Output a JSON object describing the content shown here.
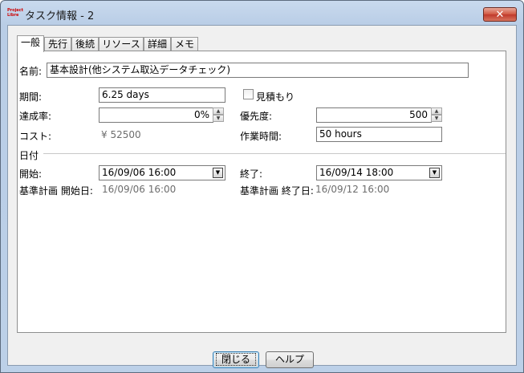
{
  "window": {
    "title": "タスク情報 - 2",
    "app_icon_text": "Project Libre"
  },
  "tabs": [
    {
      "label": "一般"
    },
    {
      "label": "先行"
    },
    {
      "label": "後続"
    },
    {
      "label": "リソース"
    },
    {
      "label": "詳細"
    },
    {
      "label": "メモ"
    }
  ],
  "general": {
    "name_label": "名前:",
    "name_value": "基本設計(他システム取込データチェック)",
    "duration_label": "期間:",
    "duration_value": "6.25 days",
    "estimate_label": "見積もり",
    "estimate_checked": false,
    "completion_label": "達成率:",
    "completion_value": "0%",
    "priority_label": "優先度:",
    "priority_value": "500",
    "cost_label": "コスト:",
    "cost_value": "¥ 52500",
    "work_label": "作業時間:",
    "work_value": "50 hours"
  },
  "dates": {
    "section_label": "日付",
    "start_label": "開始:",
    "start_value": "16/09/06 16:00",
    "end_label": "終了:",
    "end_value": "16/09/14 18:00",
    "baseline_start_label": "基準計画 開始日:",
    "baseline_start_value": "16/09/06 16:00",
    "baseline_end_label": "基準計画 終了日:",
    "baseline_end_value": "16/09/12 16:00"
  },
  "buttons": {
    "close": "閉じる",
    "help": "ヘルプ"
  }
}
